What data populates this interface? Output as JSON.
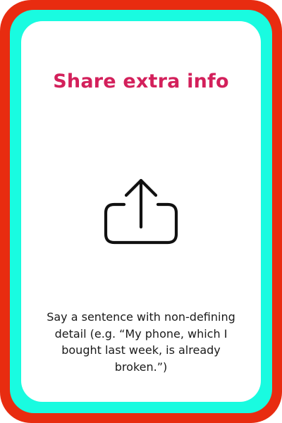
{
  "card": {
    "title": "Share extra info",
    "icon": "share-upload-icon",
    "description": "Say a sentence with non-defining detail (e.g. “My phone, which I bought last week, is already broken.”)"
  },
  "colors": {
    "outer_border": "#e82c10",
    "inner_border": "#19fbe0",
    "background": "#ffffff",
    "title": "#d3205b",
    "text": "#1a1a1a",
    "icon": "#111111"
  }
}
